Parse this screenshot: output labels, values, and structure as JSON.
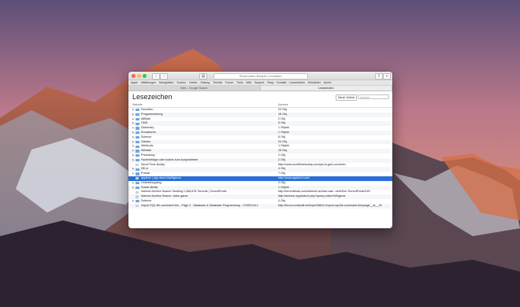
{
  "window": {
    "url": "Bookmarks-Beispiel verwalten",
    "favorites": [
      "Apple",
      "Mitteilungen",
      "Neuigkeiten",
      "Suchen",
      "Karten",
      "Zeitung",
      "Technik",
      "Forum",
      "Tools",
      "Wiki",
      "Support",
      "Shop",
      "Kontakt",
      "Lesezeichen",
      "Entwickler",
      "Archiv"
    ],
    "tabs": [
      "Web – Google Search",
      "Lesezeichen"
    ],
    "active_tab": 1
  },
  "header": {
    "title": "Lesezeichen",
    "new_folder": "Neuer Ordner",
    "search_placeholder": "Suchen"
  },
  "columns": {
    "name": "Website",
    "address": "Adresse"
  },
  "bookmarks": [
    {
      "label": "Favoriten",
      "address": "23 Obj.",
      "type": "folder",
      "expandable": true
    },
    {
      "label": "Programmierung",
      "address": "18 Obj.",
      "type": "folder",
      "expandable": true
    },
    {
      "label": "Affiliate",
      "address": "2 Obj.",
      "type": "folder",
      "expandable": true
    },
    {
      "label": "CMS",
      "address": "5 Obj.",
      "type": "folder",
      "expandable": true
    },
    {
      "label": "Dictionary",
      "address": "1 Objekt",
      "type": "folder",
      "expandable": true
    },
    {
      "label": "Emulatoren",
      "address": "1 Objekt",
      "type": "folder",
      "expandable": true
    },
    {
      "label": "Science",
      "address": "8 Obj.",
      "type": "folder",
      "expandable": true
    },
    {
      "label": "Games",
      "address": "24 Obj.",
      "type": "folder",
      "expandable": true
    },
    {
      "label": "Webtools",
      "address": "1 Objekt",
      "type": "folder",
      "expandable": true
    },
    {
      "label": "Website",
      "address": "15 Obj.",
      "type": "folder",
      "expandable": true
    },
    {
      "label": "Photoshop",
      "address": "2 Obj.",
      "type": "folder",
      "expandable": true
    },
    {
      "label": "Fachbeiträge oder solche zum Ausprobieren",
      "address": "2 Obj.",
      "type": "folder",
      "expandable": true
    },
    {
      "label": "World Time Buddy",
      "address": "http://www.worldtimebuddy.com/pst-to-gmt-converter",
      "type": "page",
      "expandable": false
    },
    {
      "label": "DE-A",
      "address": "4 Obj.",
      "type": "folder",
      "expandable": true
    },
    {
      "label": "Presse",
      "address": "7 Obj.",
      "type": "folder",
      "expandable": true
    },
    {
      "label": "apptizer | app store intelligence",
      "address": "http://www.apptizer.com/",
      "type": "page",
      "expandable": false,
      "selected": true
    },
    {
      "label": "Onlineshopping",
      "address": "3 Obj.",
      "type": "folder",
      "expandable": true
    },
    {
      "label": "Social Media",
      "address": "1 Objekt",
      "type": "folder",
      "expandable": true
    },
    {
      "label": "Internet Archive Search Seeding 1,066,676 Torrents | TorrentFreak",
      "address": "http://torrentfreak.com/internet-archive-star...eed%2a+TorrentFreak%29",
      "type": "page",
      "expandable": false
    },
    {
      "label": "Internet Archive Search: video game",
      "address": "http://archive.org/search.php?query=video%20game",
      "type": "page",
      "expandable": false
    },
    {
      "label": "Science",
      "address": "4 Obj.",
      "type": "folder",
      "expandable": true
    },
    {
      "label": "import SQL file command line - Page 2 - Database & Database Programming - CODECALL",
      "address": "http://forum.codecall.net/topic/36812-import-sql-file-command-line/page__st__15",
      "type": "page",
      "expandable": false
    }
  ]
}
